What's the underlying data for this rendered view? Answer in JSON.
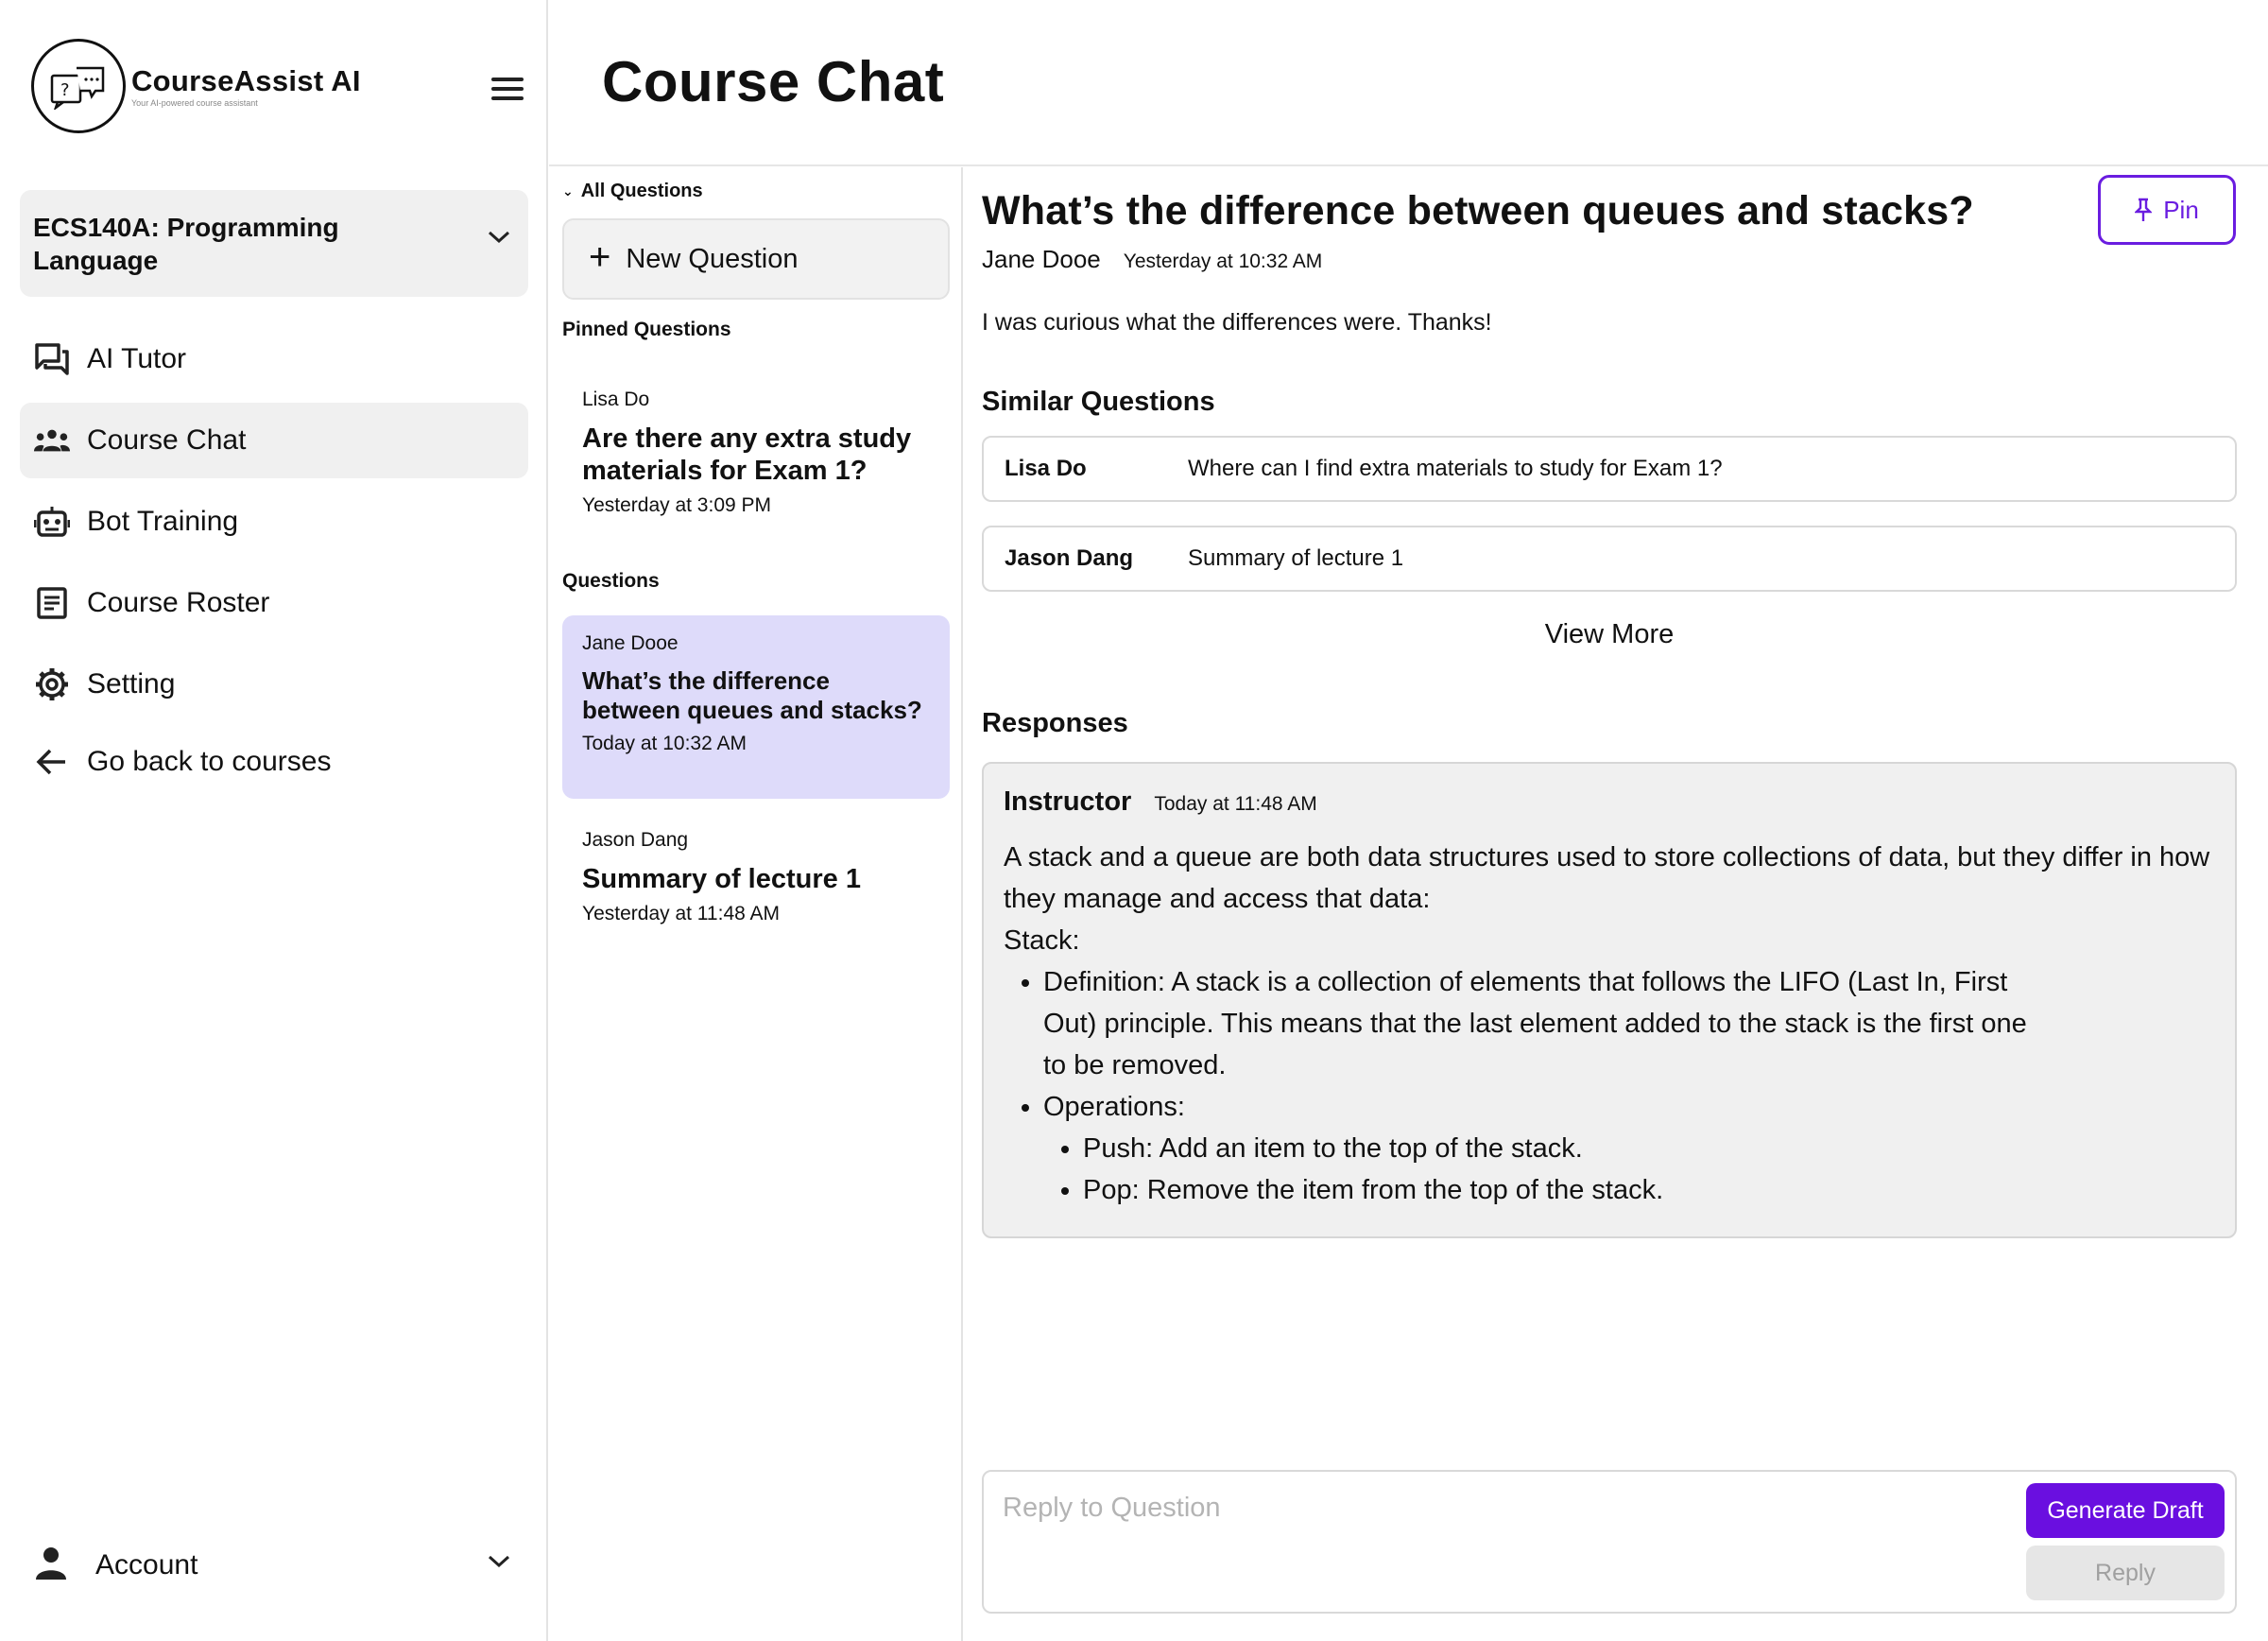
{
  "app": {
    "name": "CourseAssist AI",
    "tagline": "Your AI-powered course assistant"
  },
  "sidebar": {
    "course": "ECS140A: Programming Language",
    "items": [
      {
        "label": "AI Tutor",
        "icon": "chat-bubbles-icon"
      },
      {
        "label": "Course Chat",
        "icon": "people-group-icon",
        "active": true
      },
      {
        "label": "Bot Training",
        "icon": "robot-icon"
      },
      {
        "label": "Course Roster",
        "icon": "document-list-icon"
      },
      {
        "label": "Setting",
        "icon": "gear-icon"
      },
      {
        "label": "Go back to courses",
        "icon": "arrow-left-icon"
      }
    ],
    "account": "Account"
  },
  "header": {
    "title": "Course Chat"
  },
  "question_list": {
    "all_questions": "All Questions",
    "new_question": "New Question",
    "pinned_label": "Pinned Questions",
    "questions_label": "Questions",
    "pinned": [
      {
        "author": "Lisa Do",
        "title": "Are there any extra study materials for Exam 1?",
        "time": "Yesterday at 3:09 PM"
      }
    ],
    "questions": [
      {
        "author": "Jane Dooe",
        "title": "What’s the difference between queues and stacks?",
        "time": "Today at 10:32 AM",
        "selected": true
      },
      {
        "author": "Jason Dang",
        "title": "Summary of lecture 1",
        "time": "Yesterday at 11:48 AM"
      }
    ]
  },
  "detail": {
    "title": "What’s the difference between queues and stacks?",
    "author": "Jane Dooe",
    "time": "Yesterday at 10:32 AM",
    "pin_label": "Pin",
    "body": "I was curious what the differences were. Thanks!",
    "similar_heading": "Similar Questions",
    "similar": [
      {
        "name": "Lisa Do",
        "question": "Where can I find extra materials to study for Exam 1?"
      },
      {
        "name": "Jason Dang",
        "question": "Summary of lecture 1"
      }
    ],
    "view_more": "View More",
    "responses_heading": "Responses",
    "response": {
      "author": "Instructor",
      "time": "Today at 11:48 AM",
      "intro": "A stack and a queue are both data structures used to store collections of data, but they differ in how they manage and access that data:",
      "section": "Stack:",
      "bullets": [
        "Definition: A stack is a collection of elements that follows the LIFO (Last In, First Out) principle. This means that the last element added to the stack is the first one to be removed.",
        "Operations:"
      ],
      "sub_bullets": [
        "Push: Add an item to the top of the stack.",
        "Pop: Remove the item from the top of the stack."
      ]
    },
    "reply": {
      "placeholder": "Reply to Question",
      "generate_label": "Generate Draft",
      "reply_label": "Reply"
    }
  },
  "colors": {
    "accent": "#6a0fe0",
    "selected_card": "#dedbfa",
    "panel_gray": "#f0f0f0"
  }
}
